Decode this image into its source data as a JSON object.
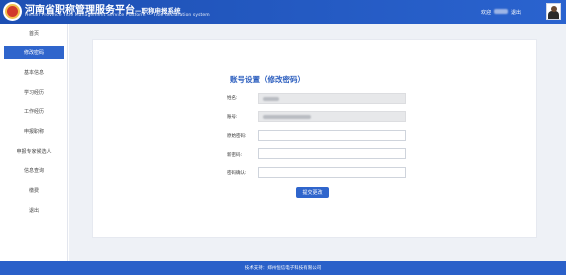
{
  "header": {
    "title": "河南省职称管理服务平台",
    "subtitle_suffix": "—职称申报系统",
    "english_subtitle": "Henan Province Title Management Service Platform — Title declaration system",
    "welcome": "欢迎",
    "logout": "退出"
  },
  "sidebar": {
    "items": [
      {
        "label": "首页",
        "active": false
      },
      {
        "label": "修改密码",
        "active": true
      },
      {
        "label": "基本信息",
        "active": false
      },
      {
        "label": "学习经历",
        "active": false
      },
      {
        "label": "工作经历",
        "active": false
      },
      {
        "label": "申报职称",
        "active": false
      },
      {
        "label": "申报专家候选人",
        "active": false
      },
      {
        "label": "信息查询",
        "active": false
      },
      {
        "label": "缴费",
        "active": false
      },
      {
        "label": "退出",
        "active": false
      }
    ]
  },
  "form": {
    "title": "账号设置（修改密码）",
    "name_label": "姓名:",
    "account_label": "账号:",
    "old_password_label": "原始密码:",
    "new_password_label": "新密码:",
    "confirm_password_label": "密码确认:",
    "old_password_value": "",
    "new_password_value": "",
    "confirm_password_value": "",
    "submit_label": "提交更改"
  },
  "footer": {
    "text": "技术支持：郑州恒信电子科技有限公司"
  },
  "colors": {
    "header": "#2a63cf",
    "accent": "#2f65cc",
    "footer": "#2a60c9"
  }
}
